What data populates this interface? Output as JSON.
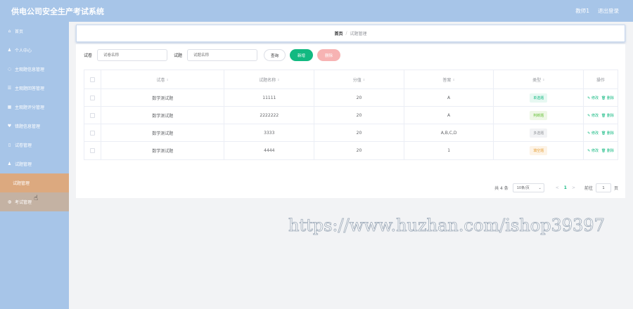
{
  "header": {
    "app_title": "供电公司安全生产考试系统",
    "user": "教师1",
    "logout": "退出登录"
  },
  "sidebar": {
    "items": [
      {
        "label": "首页",
        "icon": "home-icon",
        "glyph": "⌂"
      },
      {
        "label": "个人中心",
        "icon": "user-icon",
        "glyph": "♟"
      },
      {
        "label": "主观题信息管理",
        "icon": "circle-icon",
        "glyph": "◌"
      },
      {
        "label": "主观题回答管理",
        "icon": "list-icon",
        "glyph": "☰"
      },
      {
        "label": "主观题评分管理",
        "icon": "grade-icon",
        "glyph": "▦"
      },
      {
        "label": "错题信息管理",
        "icon": "heart-icon",
        "glyph": "♥"
      },
      {
        "label": "试卷管理",
        "icon": "doc-icon",
        "glyph": "▯"
      },
      {
        "label": "试题管理",
        "icon": "user-icon",
        "glyph": "♟"
      },
      {
        "label": "试题管理",
        "icon": "",
        "glyph": ""
      },
      {
        "label": "考试管理",
        "icon": "exam-icon",
        "glyph": "◍"
      }
    ]
  },
  "breadcrumb": {
    "home": "首页",
    "sep": "/",
    "current": "试题管理"
  },
  "search": {
    "paper_label": "试卷",
    "paper_placeholder": "试卷名称",
    "question_label": "试题",
    "question_placeholder": "试题名称",
    "query_button": "查询",
    "add_button": "新增",
    "delete_button": "删除"
  },
  "table": {
    "headers": [
      "试卷",
      "试题名称",
      "分值",
      "答案",
      "类型",
      "操作"
    ],
    "sort_glyph": "⇕",
    "edit_label": "✎ 修改",
    "delete_label": "🗑 删除",
    "rows": [
      {
        "paper": "数学测试题",
        "name": "11111",
        "score": "20",
        "answer": "A",
        "type": "单选题",
        "type_color": "#12b981",
        "type_bg": "#e7f8f2"
      },
      {
        "paper": "数学测试题",
        "name": "2222222",
        "score": "20",
        "answer": "A",
        "type": "判断题",
        "type_color": "#67c23a",
        "type_bg": "#eef7e6"
      },
      {
        "paper": "数学测试题",
        "name": "3333",
        "score": "20",
        "answer": "A,B,C,D",
        "type": "多选题",
        "type_color": "#909399",
        "type_bg": "#f2f3f5"
      },
      {
        "paper": "数学测试题",
        "name": "4444",
        "score": "20",
        "answer": "1",
        "type": "填空题",
        "type_color": "#e6a23c",
        "type_bg": "#fdf3e6"
      }
    ]
  },
  "pagination": {
    "total": "共 4 条",
    "page_size": "10条/页",
    "prev": "<",
    "current_page": "1",
    "next": ">",
    "goto_label": "前往",
    "goto_value": "1",
    "page_unit": "页"
  },
  "watermark": "https://www.huzhan.com/ishop39397"
}
